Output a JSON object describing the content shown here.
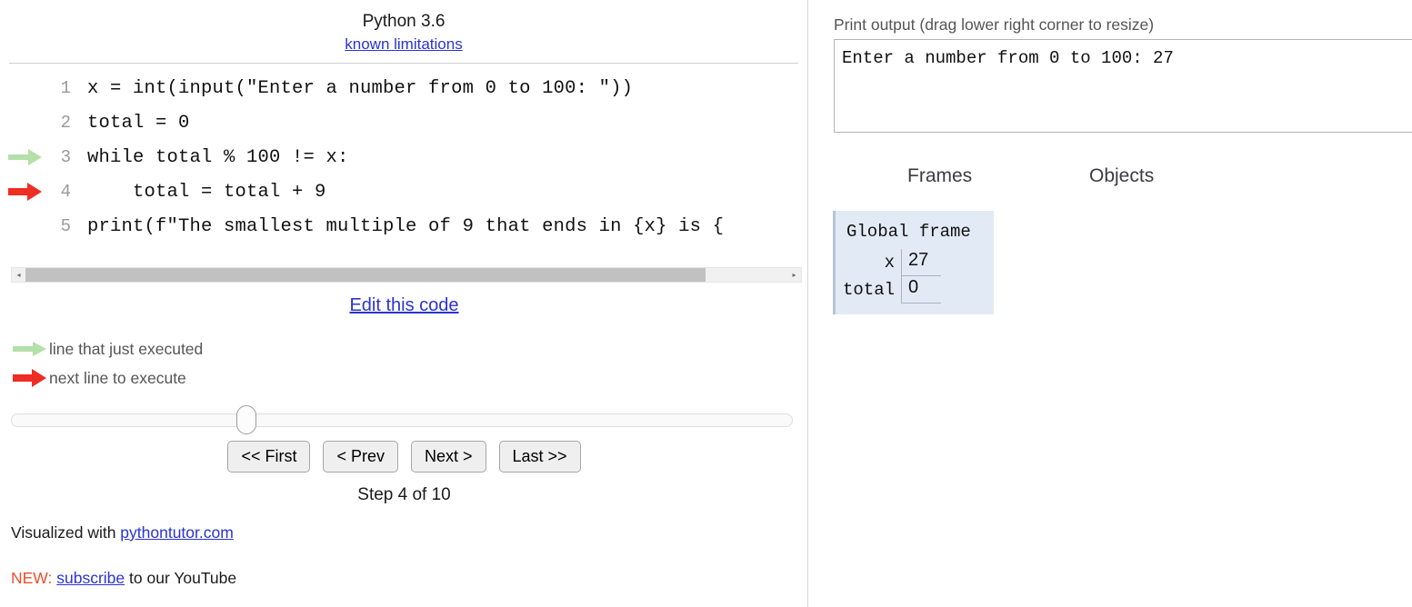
{
  "code_panel": {
    "python_version": "Python 3.6",
    "known_limitations_link": "known limitations",
    "edit_link": "Edit this code",
    "lines": [
      {
        "number": "1",
        "text": "x = int(input(\"Enter a number from 0 to 100: \"))",
        "marker": "none"
      },
      {
        "number": "2",
        "text": "total = 0",
        "marker": "none"
      },
      {
        "number": "3",
        "text": "while total % 100 != x:",
        "marker": "green"
      },
      {
        "number": "4",
        "text": "    total = total + 9",
        "marker": "red"
      },
      {
        "number": "5",
        "text": "print(f\"The smallest multiple of 9 that ends in {x} is {",
        "marker": "none"
      }
    ],
    "legend": [
      {
        "marker": "green",
        "label": "line that just executed"
      },
      {
        "marker": "red",
        "label": "next line to execute"
      }
    ],
    "scrollbar": {
      "left_arrow": "◂",
      "right_arrow": "▸"
    }
  },
  "controls": {
    "first_label": "<< First",
    "prev_label": "< Prev",
    "next_label": "Next >",
    "last_label": "Last >>",
    "step_text": "Step 4 of 10",
    "current_step": 4,
    "total_steps": 10,
    "slider_percent": 29
  },
  "footer": {
    "visualized_with": "Visualized with ",
    "site_link": "pythontutor.com",
    "new_tag": "NEW:",
    "subscribe_link": "subscribe",
    "subscribe_tail": " to our YouTube"
  },
  "output_panel": {
    "print_label": "Print output (drag lower right corner to resize)",
    "print_text": "Enter a number from 0 to 100: 27",
    "frames_header": "Frames",
    "objects_header": "Objects",
    "frame": {
      "title": "Global frame",
      "variables": [
        {
          "name": "x",
          "value": "27"
        },
        {
          "name": "total",
          "value": "0"
        }
      ]
    }
  },
  "colors": {
    "green_arrow": "#b3e0a8",
    "red_arrow": "#ee2d24",
    "link_blue": "#2b33d0",
    "new_red": "#e8502e",
    "frame_bg": "#e2eaf5"
  }
}
